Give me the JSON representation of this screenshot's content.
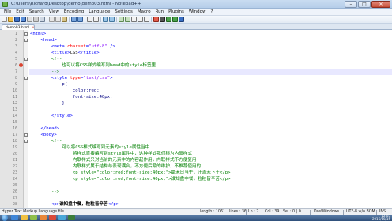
{
  "window": {
    "title": "C:\\Users\\Richard\\Desktop\\demo\\demo03.html - Notepad++",
    "minimize": "–",
    "maximize": "□",
    "close": "✕"
  },
  "menu": [
    "File",
    "Edit",
    "Search",
    "View",
    "Encoding",
    "Language",
    "Settings",
    "Macro",
    "Run",
    "Plugins",
    "Window",
    "?"
  ],
  "tab": {
    "label": "demo03.html"
  },
  "code_lines": [
    {
      "n": "1",
      "html": "<span class='c-tag'>&lt;html&gt;</span>"
    },
    {
      "n": "2",
      "html": "    <span class='c-tag'>&lt;head&gt;</span>"
    },
    {
      "n": "3",
      "html": "        <span class='c-tag'>&lt;meta </span><span class='c-attr'>charset</span><span class='c-tag'>=</span><span class='c-val'>\"utf-8\"</span><span class='c-tag'> /&gt;</span>"
    },
    {
      "n": "4",
      "html": "        <span class='c-tag'>&lt;title&gt;</span><span class='c-text'>CSS</span><span class='c-tag'>&lt;/title&gt;</span>"
    },
    {
      "n": "5",
      "html": "        <span class='c-comment'>&lt;!--</span>"
    },
    {
      "n": "6",
      "html": "<span class='c-comment'>            也可以将CSS样式编写到head中的style标签里</span>"
    },
    {
      "n": "7",
      "html": "<span class='c-comment'>        --&gt;</span>"
    },
    {
      "n": "8",
      "html": "        <span class='c-tag'>&lt;style </span><span class='c-attr'>type</span><span class='c-tag'>=</span><span class='c-val'>\"text/css\"</span><span class='c-tag'>&gt;</span>"
    },
    {
      "n": "9",
      "html": "            <span class='c-css'>p{</span>"
    },
    {
      "n": "10",
      "html": "                <span class='c-css'>color:red;</span>"
    },
    {
      "n": "11",
      "html": "                <span class='c-css'>font-size:40px;</span>"
    },
    {
      "n": "12",
      "html": "            <span class='c-css'>}</span>"
    },
    {
      "n": "13",
      "html": ""
    },
    {
      "n": "14",
      "html": "        <span class='c-tag'>&lt;/style&gt;</span>"
    },
    {
      "n": "15",
      "html": ""
    },
    {
      "n": "16",
      "html": "    <span class='c-tag'>&lt;/head&gt;</span>"
    },
    {
      "n": "17",
      "html": "    <span class='c-tag'>&lt;body&gt;</span>"
    },
    {
      "n": "18",
      "html": "        <span class='c-comment'>&lt;!--</span>"
    },
    {
      "n": "19",
      "html": "<span class='c-comment'>            可以将CSS样式编写到元素的style属性当中</span>"
    },
    {
      "n": "20",
      "html": "<span class='c-comment'>                将样式直接编写到style属性中，这种样式我们称为内联样式</span>"
    },
    {
      "n": "21",
      "html": "<span class='c-comment'>                内联样式只对当前的元素中的内容起作用，内联样式不方便复用</span>"
    },
    {
      "n": "22",
      "html": "<span class='c-comment'>                内联样式属于结构与表现耦合，不方便后期的维护，不推荐使用的</span>"
    },
    {
      "n": "23",
      "html": "<span class='c-comment'>                &lt;p style=\"color:red;font-size:40px;\"&gt;锄禾日当午，汗滴禾下土&lt;/p&gt;</span>"
    },
    {
      "n": "24",
      "html": "<span class='c-comment'>                &lt;p style=\"color:red;font-size:40px;\"&gt;谁知盘中餐，粒粒皆辛苦&lt;/p&gt;</span>"
    },
    {
      "n": "25",
      "html": ""
    },
    {
      "n": "26",
      "html": "<span class='c-comment'>        --&gt;</span>"
    },
    {
      "n": "27",
      "html": ""
    },
    {
      "n": "28",
      "html": "        <span class='c-tag'>&lt;p&gt;</span><span class='c-bold'>谁知盘中餐，粒粒皆辛苦</span><span class='c-tag'>&lt;/p&gt;</span>"
    }
  ],
  "status": {
    "language": "Hyper Text Markup Language file",
    "length": "length : 1061",
    "lines": "lines : 36",
    "ln": "Ln : 7",
    "col": "Col : 39",
    "sel": "Sel : 0 | 0",
    "eol": "Dos\\Windows",
    "encoding": "UTF-8 w/o BOM",
    "mode": "INS"
  },
  "taskbar": {
    "time": "12:05",
    "date": "2016/10/15"
  },
  "colors": {
    "tag": "#0000ff",
    "attr": "#ff0000",
    "value": "#8000ff",
    "comment": "#008000",
    "current_line": "#e8e8ff"
  }
}
